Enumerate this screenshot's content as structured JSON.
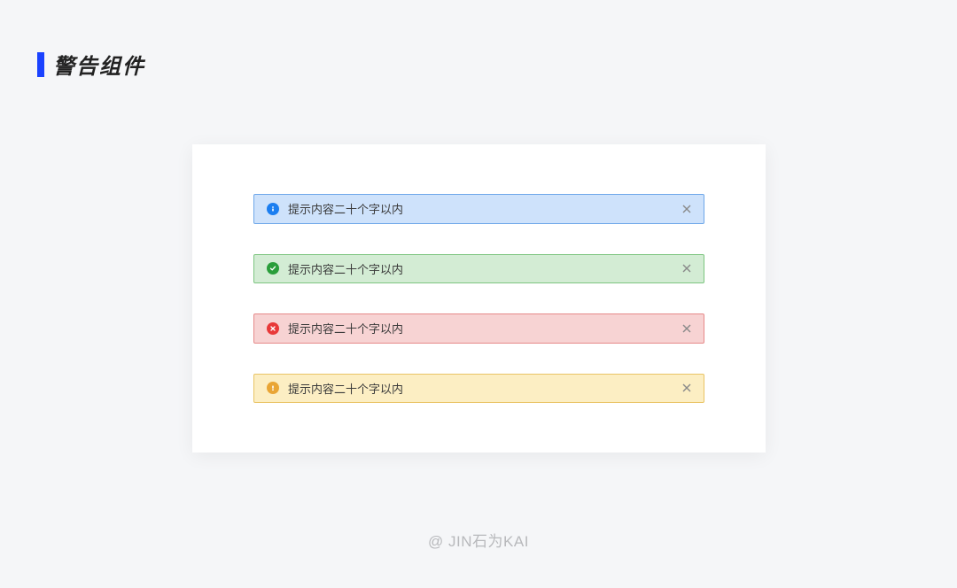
{
  "header": {
    "title": "警告组件"
  },
  "alerts": [
    {
      "type": "info",
      "text": "提示内容二十个字以内"
    },
    {
      "type": "success",
      "text": "提示内容二十个字以内"
    },
    {
      "type": "error",
      "text": "提示内容二十个字以内"
    },
    {
      "type": "warning",
      "text": "提示内容二十个字以内"
    }
  ],
  "watermark": "@ JIN石为KAI",
  "colors": {
    "accent": "#1a42ff",
    "info": {
      "bg": "#cee2fb",
      "border": "#6ea7e9",
      "icon": "#1b7ef0"
    },
    "success": {
      "bg": "#d3ecd4",
      "border": "#7dc580",
      "icon": "#2a9e3b"
    },
    "error": {
      "bg": "#f7d3d3",
      "border": "#e68a8a",
      "icon": "#e83939"
    },
    "warning": {
      "bg": "#fceec3",
      "border": "#e9c465",
      "icon": "#e9a535"
    }
  }
}
